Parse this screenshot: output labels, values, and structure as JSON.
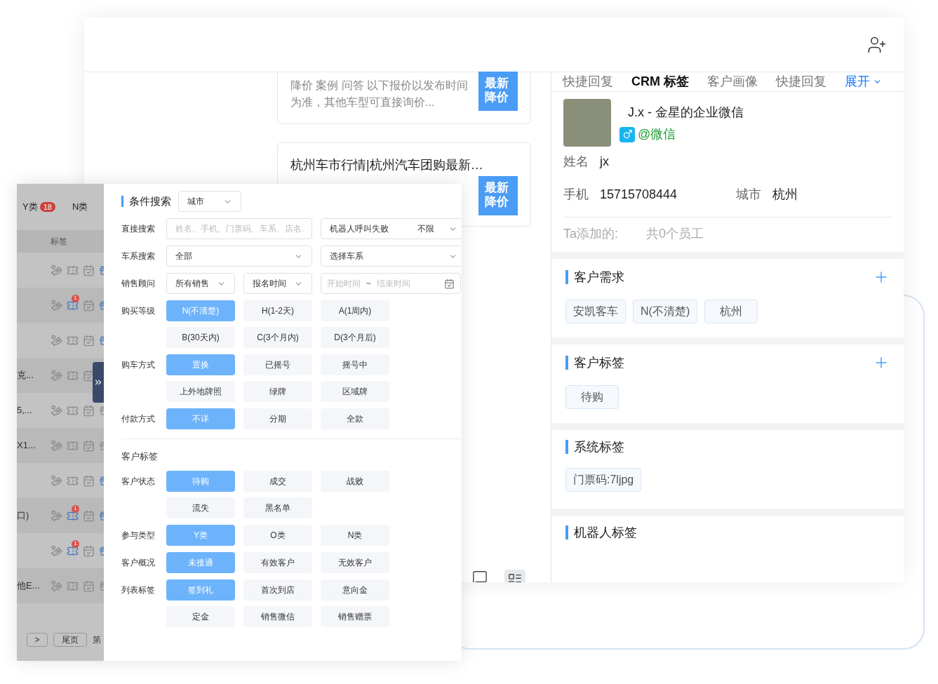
{
  "articles": [
    {
      "description": "降价 案例 问答 以下报价以发布时间为准，其他车型可直接询价...",
      "badge": "最新降价"
    },
    {
      "title": "杭州车市行情|杭州汽车团购最新…",
      "badge": "最新降价"
    }
  ],
  "crm": {
    "tabs": [
      {
        "label": "快捷回复",
        "selected": false
      },
      {
        "label": "CRM 标签",
        "selected": true
      },
      {
        "label": "客户画像",
        "selected": false
      },
      {
        "label": "快捷回复",
        "selected": false
      }
    ],
    "expand_label": "展开",
    "profile": {
      "name": "J.x - 金星的企业微信",
      "source": "@微信",
      "fields": [
        {
          "label": "姓名",
          "value": "jx"
        },
        {
          "label": "手机",
          "value": "15715708444"
        },
        {
          "label": "城市",
          "value": "杭州"
        }
      ],
      "added_label": "Ta添加的:",
      "added_value": "共0个员工"
    },
    "sections": [
      {
        "title": "客户需求",
        "addable": true,
        "tags": [
          "安凯客车",
          "N(不清楚)",
          "杭州"
        ]
      },
      {
        "title": "客户标签",
        "addable": true,
        "tags": [
          "待购"
        ]
      },
      {
        "title": "系统标签",
        "addable": false,
        "tags": [
          "门票码:7ljpg"
        ]
      },
      {
        "title": "机器人标签",
        "addable": false
      }
    ]
  },
  "customer_list": {
    "tabs": [
      {
        "label": "Y类",
        "count": "18"
      },
      {
        "label": "N类"
      }
    ],
    "column": "标签",
    "rows": [
      {
        "ticket_badge": null,
        "gift_active": true
      },
      {
        "ticket_badge": "1",
        "gift_active": true
      },
      {
        "ticket_badge": null,
        "gift_active": true
      },
      {
        "text": "克...",
        "ticket_badge": null
      },
      {
        "text": "5,...",
        "ticket_badge": null,
        "gift_active": false
      },
      {
        "text": "X1...",
        "ticket_badge": null,
        "gift_active": false
      },
      {
        "ticket_badge": null,
        "gift_active": true
      },
      {
        "text": "口)",
        "ticket_badge": "1",
        "gift_active": true
      },
      {
        "ticket_badge": "1",
        "gift_active": true
      },
      {
        "text": "他E...",
        "ticket_badge": null,
        "gift_active": false
      }
    ],
    "pagination": {
      "next": ">",
      "last": "尾页",
      "page_prefix": "第"
    }
  },
  "filter": {
    "title": "条件搜索",
    "city_select": "城市",
    "rows": [
      {
        "kind": "fields",
        "label": "直接搜索",
        "fields": [
          {
            "kind": "input",
            "placeholder": "姓名、手机、门票码、车系、店名."
          },
          {
            "kind": "select",
            "label": "机器人呼叫失败",
            "value": "不限"
          }
        ]
      },
      {
        "kind": "fields",
        "label": "车系搜索",
        "fields": [
          {
            "kind": "select",
            "label": "全部"
          },
          {
            "kind": "select",
            "label": "选择车系"
          }
        ]
      },
      {
        "kind": "fields",
        "label": "销售顾问",
        "fields": [
          {
            "kind": "small_select",
            "label": "所有销售"
          },
          {
            "kind": "small_select",
            "label": "报名时间"
          },
          {
            "kind": "date_range",
            "start": "开始时间",
            "separator": "~",
            "end": "结束时间"
          }
        ]
      },
      {
        "kind": "chips",
        "label": "购买等级",
        "options": [
          {
            "label": "N(不清楚)",
            "selected": true
          },
          {
            "label": "H(1-2天)",
            "selected": false
          },
          {
            "label": "A(1周内)",
            "selected": false
          },
          {
            "label": "B(30天内)",
            "selected": false
          },
          {
            "label": "C(3个月内)",
            "selected": false
          },
          {
            "label": "D(3个月后)",
            "selected": false
          }
        ]
      },
      {
        "kind": "chips",
        "label": "购车方式",
        "options": [
          {
            "label": "置换",
            "selected": true
          },
          {
            "label": "已摇号",
            "selected": false
          },
          {
            "label": "摇号中",
            "selected": false
          },
          {
            "label": "上外地牌照",
            "selected": false
          },
          {
            "label": "绿牌",
            "selected": false
          },
          {
            "label": "区域牌",
            "selected": false
          }
        ]
      },
      {
        "kind": "chips",
        "label": "付款方式",
        "options": [
          {
            "label": "不详",
            "selected": true
          },
          {
            "label": "分期",
            "selected": false
          },
          {
            "label": "全款",
            "selected": false
          }
        ]
      },
      {
        "kind": "heading",
        "label": "客户标签"
      },
      {
        "kind": "chips",
        "label": "客户状态",
        "options": [
          {
            "label": "待购",
            "selected": true
          },
          {
            "label": "成交",
            "selected": false
          },
          {
            "label": "战败",
            "selected": false
          },
          {
            "label": "流失",
            "selected": false
          },
          {
            "label": "黑名单",
            "selected": false
          }
        ]
      },
      {
        "kind": "chips",
        "label": "参与类型",
        "options": [
          {
            "label": "Y类",
            "selected": true
          },
          {
            "label": "O类",
            "selected": false
          },
          {
            "label": "N类",
            "selected": false
          }
        ]
      },
      {
        "kind": "chips",
        "label": "客户概况",
        "options": [
          {
            "label": "未接通",
            "selected": true
          },
          {
            "label": "有效客户",
            "selected": false
          },
          {
            "label": "无效客户",
            "selected": false
          }
        ]
      },
      {
        "kind": "chips",
        "label": "列表标签",
        "options": [
          {
            "label": "签到礼",
            "selected": true
          },
          {
            "label": "首次到店",
            "selected": false
          },
          {
            "label": "意向金",
            "selected": false
          },
          {
            "label": "定金",
            "selected": false
          },
          {
            "label": "销售微信",
            "selected": false
          },
          {
            "label": "销售赠票",
            "selected": false
          }
        ]
      }
    ]
  }
}
